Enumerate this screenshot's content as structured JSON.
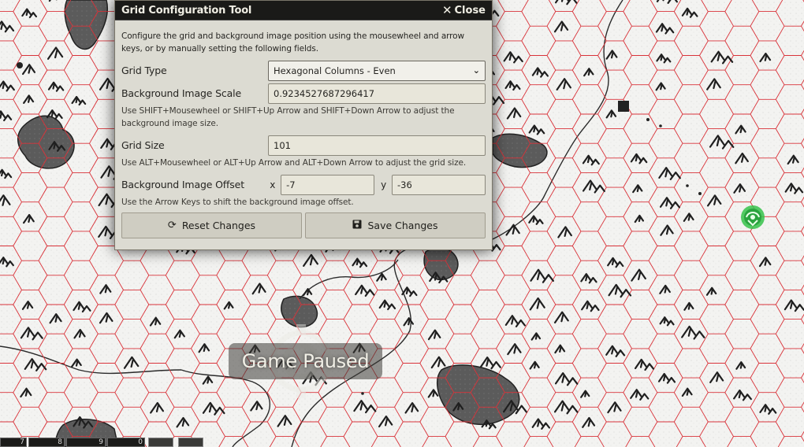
{
  "dialog": {
    "title": "Grid Configuration Tool",
    "close_label": "Close",
    "intro": "Configure the grid and background image position using the mousewheel and arrow keys, or by manually setting the following fields.",
    "grid_type": {
      "label": "Grid Type",
      "value": "Hexagonal Columns - Even"
    },
    "bg_scale": {
      "label": "Background Image Scale",
      "value": "0.9234527687296417",
      "hint": "Use SHIFT+Mousewheel or SHIFT+Up Arrow and SHIFT+Down Arrow to adjust the background image size."
    },
    "grid_size": {
      "label": "Grid Size",
      "value": "101",
      "hint": "Use ALT+Mousewheel or ALT+Up Arrow and ALT+Down Arrow to adjust the grid size."
    },
    "bg_offset": {
      "label": "Background Image Offset",
      "x_label": "x",
      "x_value": "-7",
      "y_label": "y",
      "y_value": "-36",
      "hint": "Use the Arrow Keys to shift the background image offset."
    },
    "reset_label": "Reset Changes",
    "save_label": "Save Changes"
  },
  "paused": {
    "text": "Game Paused"
  },
  "hotbar": {
    "slots": [
      "7",
      "8",
      "9",
      "0"
    ]
  },
  "colors": {
    "grid_line": "#d9333a",
    "map_paper": "#f3f3f1",
    "map_ink": "#262626",
    "token": "#35c24a",
    "dialog_bg": "#dcdbd2",
    "dialog_header": "#1a1a18"
  }
}
